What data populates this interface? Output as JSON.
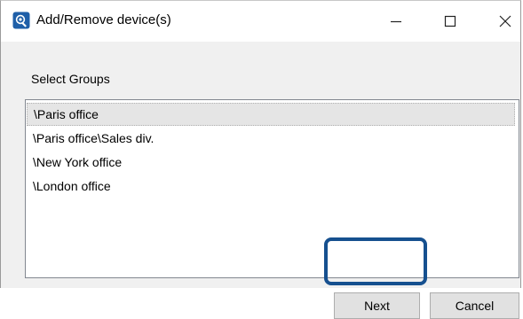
{
  "window": {
    "title": "Add/Remove device(s)",
    "app_icon": "device-management-icon",
    "controls": {
      "minimize": "minimize-icon",
      "maximize": "maximize-icon",
      "close": "close-icon"
    }
  },
  "main": {
    "select_label": "Select Groups",
    "groups": [
      {
        "label": "\\Paris office",
        "selected": true
      },
      {
        "label": "\\Paris office\\Sales div.",
        "selected": false
      },
      {
        "label": "\\New York office",
        "selected": false
      },
      {
        "label": "\\London office",
        "selected": false
      }
    ]
  },
  "buttons": {
    "next_label": "Next",
    "cancel_label": "Cancel"
  },
  "colors": {
    "highlight": "#16508f",
    "selection": "#e5e5e5",
    "dialog_bg": "#f0f0f0"
  }
}
